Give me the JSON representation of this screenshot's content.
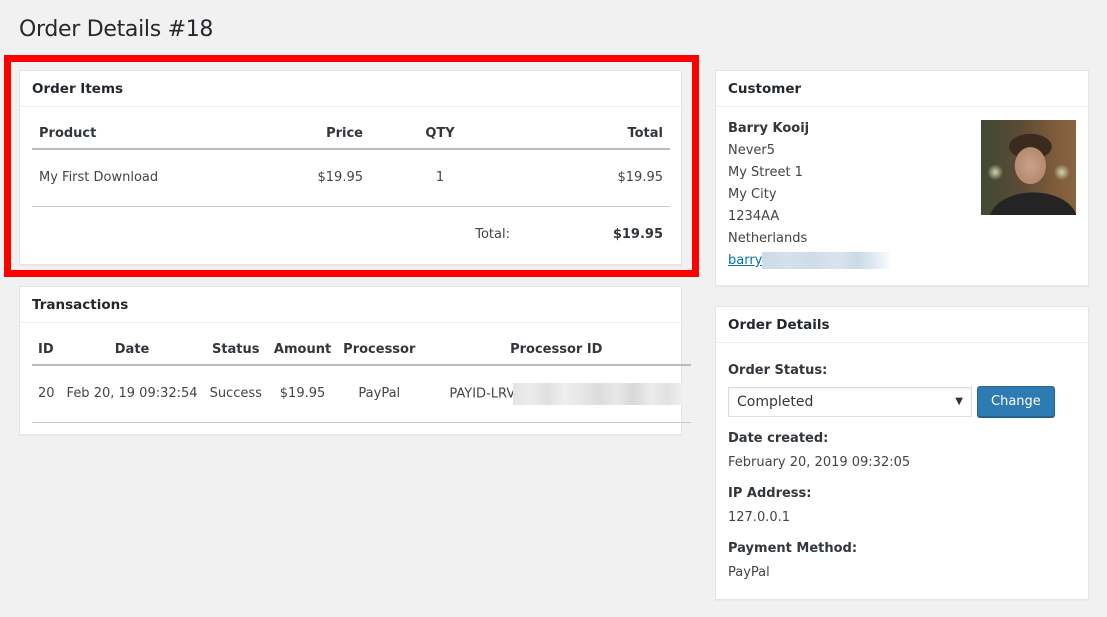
{
  "page": {
    "title": "Order Details #18"
  },
  "order_items": {
    "title": "Order Items",
    "columns": [
      "Product",
      "Price",
      "QTY",
      "Total"
    ],
    "rows": [
      {
        "product": "My First Download",
        "price": "$19.95",
        "qty": "1",
        "total": "$19.95"
      }
    ],
    "total_label": "Total:",
    "total_value": "$19.95"
  },
  "transactions": {
    "title": "Transactions",
    "columns": [
      "ID",
      "Date",
      "Status",
      "Amount",
      "Processor",
      "Processor ID"
    ],
    "rows": [
      {
        "id": "20",
        "date": "Feb 20, 19 09:32:54",
        "status": "Success",
        "amount": "$19.95",
        "processor": "PayPal",
        "processor_id_visible": "PAYID-LRV"
      }
    ]
  },
  "customer": {
    "title": "Customer",
    "name": "Barry Kooij",
    "company": "Never5",
    "street": "My Street 1",
    "city": "My City",
    "postcode": "1234AA",
    "country": "Netherlands",
    "email_visible": "barry"
  },
  "order_details": {
    "title": "Order Details",
    "status_label": "Order Status:",
    "status_selected": "Completed",
    "change_button": "Change",
    "date_label": "Date created:",
    "date_value": "February 20, 2019 09:32:05",
    "ip_label": "IP Address:",
    "ip_value": "127.0.0.1",
    "payment_label": "Payment Method:",
    "payment_value": "PayPal"
  },
  "colors": {
    "highlight": "#ff0000",
    "button": "#2e7ab3",
    "link": "#0073aa"
  }
}
